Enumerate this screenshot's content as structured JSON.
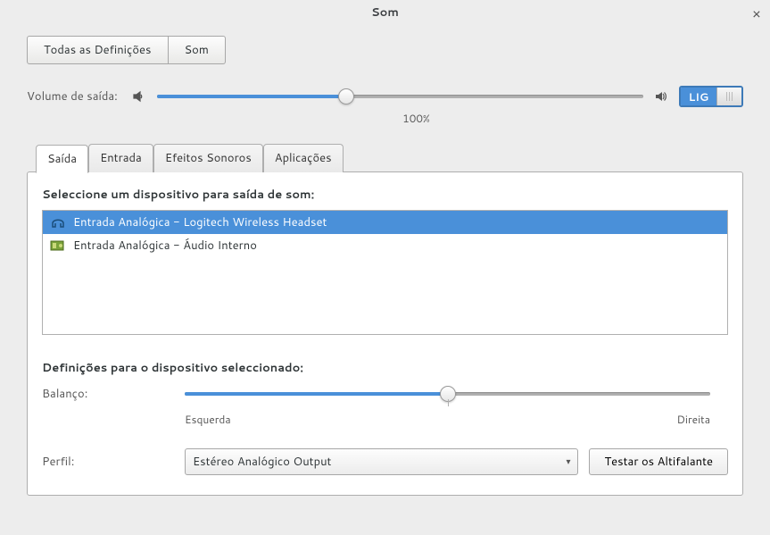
{
  "window": {
    "title": "Som"
  },
  "breadcrumb": {
    "all": "Todas as Definições",
    "current": "Som"
  },
  "volume": {
    "label": "Volume de saída:",
    "percent_label": "100%",
    "fill_percent": 39,
    "toggle_on_label": "LIG"
  },
  "tabs": {
    "output": "Saída",
    "input": "Entrada",
    "effects": "Efeitos Sonoros",
    "apps": "Aplicações"
  },
  "output_panel": {
    "select_device_title": "Seleccione um dispositivo para saída de som:",
    "devices": [
      {
        "label": "Entrada Analógica - Logitech Wireless Headset",
        "selected": true
      },
      {
        "label": "Entrada Analógica - Áudio Interno",
        "selected": false
      }
    ],
    "device_settings_title": "Definições para o dispositivo seleccionado:",
    "balance": {
      "label": "Balanço:",
      "left": "Esquerda",
      "right": "Direita",
      "fill_percent": 50
    },
    "profile": {
      "label": "Perfil:",
      "selected": "Estéreo Analógico Output",
      "test_button": "Testar os Altifalante"
    }
  }
}
